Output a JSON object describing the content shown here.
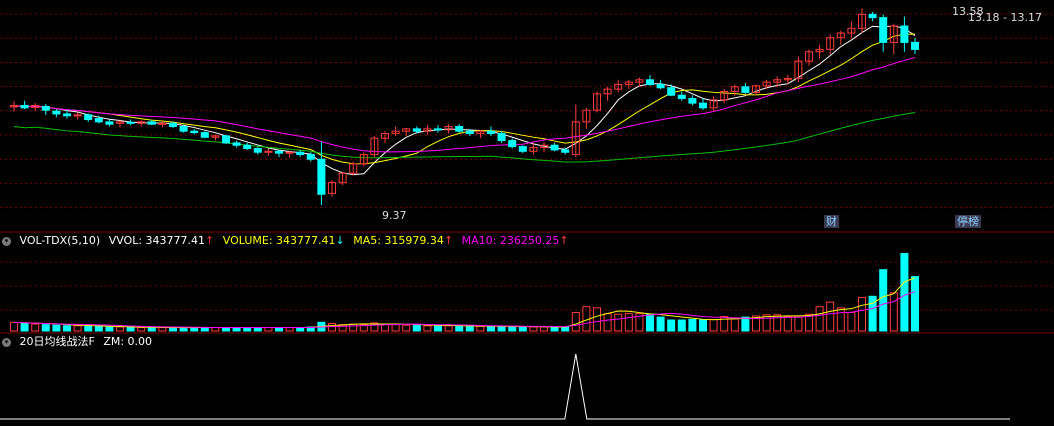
{
  "price_panel": {
    "high_label": "13.58",
    "low_label": "9.37",
    "range_label": "13.18 - 13.17",
    "events": [
      "财",
      "停榜"
    ]
  },
  "volume_panel": {
    "indicator_name": "VOL-TDX(5,10)",
    "vvol_label": "VVOL: 343777.41",
    "volume_label": "VOLUME: 343777.41",
    "ma5_label": "MA5: 315979.34",
    "ma10_label": "MA10: 236250.25"
  },
  "signal_panel": {
    "indicator_name": "20日均线战法F",
    "zm_label": "ZM: 0.00"
  },
  "colors": {
    "up": "#ff3b3b",
    "down": "#00ffff",
    "ma_white": "#ffffff",
    "ma_yellow": "#ffff00",
    "ma_magenta": "#ff00ff",
    "ma_green": "#00c000",
    "grid": "#7a0000"
  },
  "chart_data": {
    "type": "candlestick",
    "ylim": [
      9.2,
      13.65
    ],
    "candles": [
      [
        11.47,
        11.59,
        11.37,
        11.5
      ],
      [
        11.5,
        11.6,
        11.42,
        11.45
      ],
      [
        11.46,
        11.55,
        11.38,
        11.5
      ],
      [
        11.48,
        11.53,
        11.3,
        11.4
      ],
      [
        11.38,
        11.42,
        11.25,
        11.32
      ],
      [
        11.32,
        11.4,
        11.22,
        11.28
      ],
      [
        11.28,
        11.35,
        11.2,
        11.3
      ],
      [
        11.3,
        11.33,
        11.15,
        11.2
      ],
      [
        11.22,
        11.28,
        11.12,
        11.15
      ],
      [
        11.15,
        11.2,
        11.05,
        11.1
      ],
      [
        11.12,
        11.18,
        11.03,
        11.15
      ],
      [
        11.14,
        11.2,
        11.08,
        11.12
      ],
      [
        11.12,
        11.18,
        11.05,
        11.15
      ],
      [
        11.15,
        11.19,
        11.08,
        11.1
      ],
      [
        11.1,
        11.15,
        11.03,
        11.12
      ],
      [
        11.12,
        11.16,
        11.02,
        11.05
      ],
      [
        11.05,
        11.08,
        10.92,
        10.95
      ],
      [
        10.95,
        11.0,
        10.88,
        10.92
      ],
      [
        10.92,
        10.95,
        10.8,
        10.82
      ],
      [
        10.82,
        10.88,
        10.75,
        10.85
      ],
      [
        10.85,
        10.88,
        10.68,
        10.7
      ],
      [
        10.7,
        10.75,
        10.6,
        10.65
      ],
      [
        10.65,
        10.7,
        10.55,
        10.58
      ],
      [
        10.58,
        10.62,
        10.45,
        10.5
      ],
      [
        10.5,
        10.58,
        10.42,
        10.52
      ],
      [
        10.52,
        10.55,
        10.4,
        10.48
      ],
      [
        10.48,
        10.52,
        10.38,
        10.5
      ],
      [
        10.5,
        10.55,
        10.4,
        10.45
      ],
      [
        10.45,
        10.5,
        10.3,
        10.35
      ],
      [
        10.35,
        10.72,
        9.37,
        9.6
      ],
      [
        9.62,
        9.9,
        9.55,
        9.85
      ],
      [
        9.85,
        10.08,
        9.8,
        10.05
      ],
      [
        10.05,
        10.3,
        10.0,
        10.25
      ],
      [
        10.25,
        10.5,
        10.2,
        10.45
      ],
      [
        10.45,
        10.85,
        10.4,
        10.8
      ],
      [
        10.8,
        10.95,
        10.7,
        10.9
      ],
      [
        10.9,
        11.05,
        10.85,
        10.95
      ],
      [
        10.95,
        11.02,
        10.85,
        11.0
      ],
      [
        11.0,
        11.05,
        10.9,
        10.95
      ],
      [
        10.95,
        11.08,
        10.88,
        11.0
      ],
      [
        11.0,
        11.08,
        10.92,
        10.98
      ],
      [
        10.98,
        11.1,
        10.9,
        11.05
      ],
      [
        11.05,
        11.1,
        10.92,
        10.95
      ],
      [
        10.95,
        11.0,
        10.85,
        10.9
      ],
      [
        10.9,
        10.98,
        10.8,
        10.95
      ],
      [
        10.95,
        11.05,
        10.85,
        10.9
      ],
      [
        10.9,
        10.95,
        10.7,
        10.75
      ],
      [
        10.75,
        10.8,
        10.58,
        10.62
      ],
      [
        10.62,
        10.65,
        10.48,
        10.52
      ],
      [
        10.52,
        10.7,
        10.45,
        10.6
      ],
      [
        10.6,
        10.72,
        10.5,
        10.65
      ],
      [
        10.65,
        10.7,
        10.52,
        10.55
      ],
      [
        10.55,
        10.6,
        10.45,
        10.5
      ],
      [
        10.45,
        11.52,
        10.4,
        11.15
      ],
      [
        11.15,
        11.45,
        11.0,
        11.4
      ],
      [
        11.4,
        11.8,
        11.35,
        11.75
      ],
      [
        11.75,
        11.9,
        11.6,
        11.85
      ],
      [
        11.85,
        12.05,
        11.78,
        11.95
      ],
      [
        11.95,
        12.05,
        11.85,
        12.0
      ],
      [
        12.0,
        12.1,
        11.9,
        12.05
      ],
      [
        12.05,
        12.15,
        11.92,
        11.95
      ],
      [
        11.95,
        12.05,
        11.85,
        11.88
      ],
      [
        11.88,
        11.95,
        11.7,
        11.72
      ],
      [
        11.72,
        11.8,
        11.6,
        11.65
      ],
      [
        11.65,
        11.72,
        11.5,
        11.55
      ],
      [
        11.55,
        11.65,
        11.4,
        11.45
      ],
      [
        11.45,
        11.7,
        11.38,
        11.62
      ],
      [
        11.62,
        11.85,
        11.55,
        11.8
      ],
      [
        11.8,
        11.95,
        11.7,
        11.9
      ],
      [
        11.9,
        11.98,
        11.75,
        11.78
      ],
      [
        11.78,
        11.95,
        11.72,
        11.92
      ],
      [
        11.92,
        12.05,
        11.85,
        12.0
      ],
      [
        12.0,
        12.12,
        11.9,
        12.05
      ],
      [
        12.05,
        12.15,
        11.95,
        12.08
      ],
      [
        12.08,
        12.55,
        12.0,
        12.45
      ],
      [
        12.45,
        12.7,
        12.35,
        12.65
      ],
      [
        12.65,
        12.8,
        12.5,
        12.7
      ],
      [
        12.7,
        13.02,
        12.6,
        12.95
      ],
      [
        12.95,
        13.1,
        12.8,
        13.05
      ],
      [
        13.05,
        13.3,
        12.95,
        13.15
      ],
      [
        13.15,
        13.58,
        13.05,
        13.45
      ],
      [
        13.45,
        13.5,
        13.3,
        13.38
      ],
      [
        13.38,
        13.45,
        12.65,
        12.85
      ],
      [
        12.85,
        13.25,
        12.6,
        13.2
      ],
      [
        13.2,
        13.4,
        12.65,
        12.85
      ],
      [
        12.85,
        12.95,
        12.6,
        12.7
      ]
    ],
    "volumes": [
      0.75,
      0.68,
      0.6,
      0.55,
      0.5,
      0.45,
      0.45,
      0.4,
      0.4,
      0.35,
      0.35,
      0.3,
      0.3,
      0.3,
      0.3,
      0.3,
      0.3,
      0.3,
      0.3,
      0.3,
      0.3,
      0.3,
      0.3,
      0.3,
      0.3,
      0.3,
      0.3,
      0.3,
      0.35,
      0.75,
      0.65,
      0.55,
      0.6,
      0.55,
      0.7,
      0.6,
      0.55,
      0.5,
      0.5,
      0.45,
      0.45,
      0.45,
      0.45,
      0.4,
      0.4,
      0.4,
      0.4,
      0.4,
      0.35,
      0.35,
      0.35,
      0.35,
      0.35,
      1.6,
      2.1,
      2.0,
      1.5,
      1.45,
      1.5,
      1.5,
      1.45,
      1.2,
      0.95,
      0.95,
      1.0,
      0.95,
      1.0,
      1.25,
      1.05,
      1.2,
      1.3,
      1.4,
      1.4,
      1.25,
      1.2,
      1.45,
      2.1,
      2.5,
      2.0,
      1.6,
      2.9,
      3.0,
      5.3,
      3.3,
      6.7,
      4.7
    ],
    "volume_ylim": [
      0,
      7
    ],
    "signal": {
      "peak_index": 53,
      "value": 1
    }
  }
}
